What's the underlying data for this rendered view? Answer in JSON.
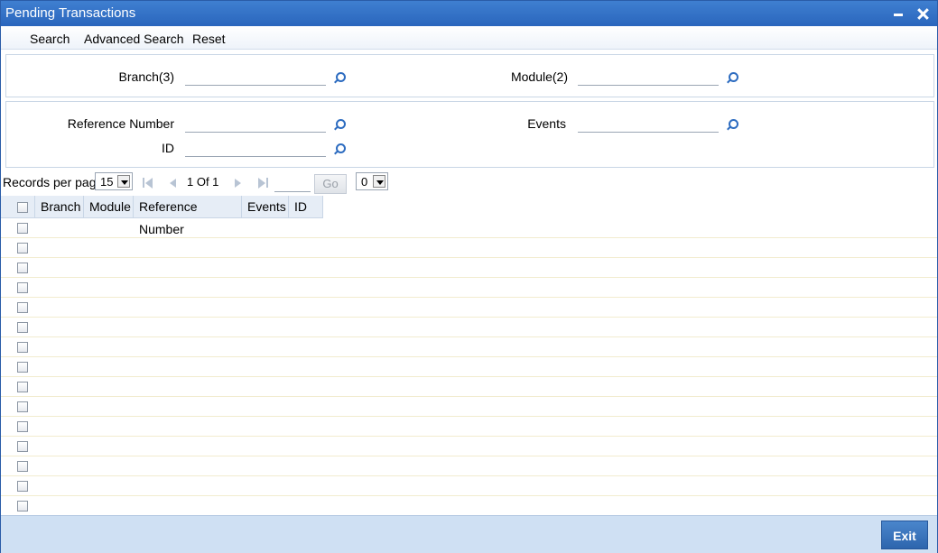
{
  "window": {
    "title": "Pending Transactions"
  },
  "toolbar": {
    "search": "Search",
    "advanced_search": "Advanced Search",
    "reset": "Reset"
  },
  "fields": {
    "branch_label": "Branch(3)",
    "module_label": "Module(2)",
    "reference_label": "Reference Number",
    "events_label": "Events",
    "id_label": "ID",
    "branch_value": "",
    "module_value": "",
    "reference_value": "",
    "events_value": "",
    "id_value": ""
  },
  "pager": {
    "records_per_page_label": "Records per page",
    "records_per_page": "15",
    "page_info": "1 Of 1",
    "go_label": "Go",
    "goto_value": "",
    "page_select": "0"
  },
  "grid": {
    "columns": [
      "Branch",
      "Module",
      "Reference Number",
      "Events",
      "ID"
    ],
    "row_count": 15
  },
  "footer": {
    "exit": "Exit"
  }
}
